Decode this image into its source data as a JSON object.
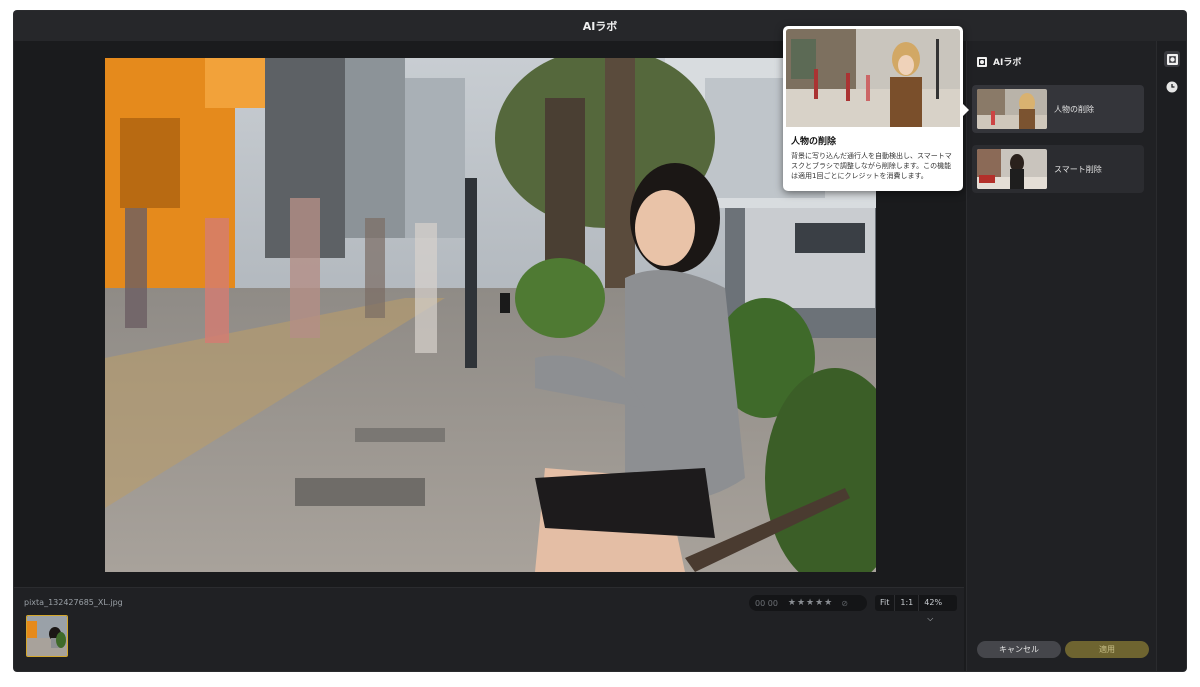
{
  "window": {
    "title": "AIラボ"
  },
  "filmstrip": {
    "filename": "pixta_132427685_XL.jpg"
  },
  "rating": {
    "flag_label": "00 00",
    "stars": "★★★★★",
    "reject": "⊘"
  },
  "zoom": {
    "fit": "Fit",
    "one_to_one": "1:1",
    "percent": "42%",
    "chevron": "⌵"
  },
  "panel": {
    "title": "AIラボ",
    "items": [
      {
        "label": "人物の削除"
      },
      {
        "label": "スマート削除"
      }
    ],
    "cancel_label": "キャンセル",
    "apply_label": "適用"
  },
  "tooltip": {
    "title": "人物の削除",
    "description": "背景に写り込んだ通行人を自動検出し、スマートマスクとブラシで調整しながら削除します。この機能は適用1回ごとにクレジットを消費します。"
  },
  "colors": {
    "accent": "#d4a72c",
    "apply_bg": "#6e6430",
    "panel_bg": "#202124",
    "app_bg": "#1a1b1d"
  }
}
